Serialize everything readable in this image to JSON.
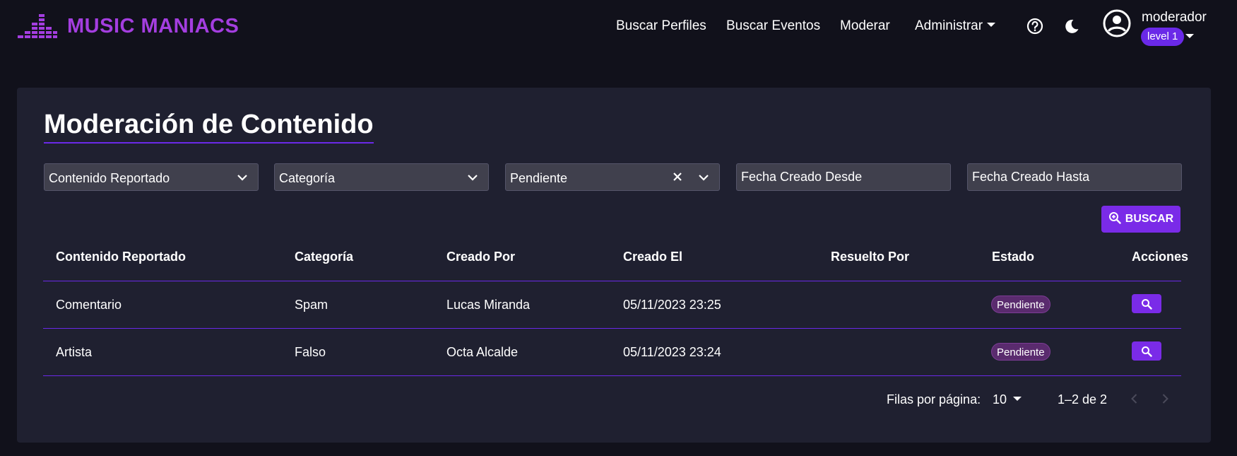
{
  "app": {
    "brand_name": "MUSIC MANIACS",
    "brand_icon": "equalizer-bars-icon",
    "accent_color": "#a43ee0",
    "primary_color": "#7a2be8"
  },
  "nav": {
    "items": [
      {
        "label": "Buscar Perfiles"
      },
      {
        "label": "Buscar Eventos"
      },
      {
        "label": "Moderar"
      },
      {
        "label": "Administrar"
      }
    ],
    "help_icon": "help-circle-icon",
    "theme_icon": "moon-icon"
  },
  "user": {
    "name": "moderador",
    "level": "level 1",
    "avatar_icon": "account-circle-icon"
  },
  "page": {
    "title": "Moderación de Contenido"
  },
  "filters": {
    "content_type": {
      "value": "Contenido Reportado"
    },
    "category": {
      "value": "Categoría"
    },
    "status": {
      "value": "Pendiente"
    },
    "date_from": {
      "placeholder": "Fecha Creado Desde"
    },
    "date_to": {
      "placeholder": "Fecha Creado Hasta"
    },
    "search_label": "BUSCAR"
  },
  "table": {
    "headers": {
      "content": "Contenido Reportado",
      "category": "Categoría",
      "created_by": "Creado Por",
      "created_at": "Creado El",
      "resolved_by": "Resuelto Por",
      "status": "Estado",
      "actions": "Acciones"
    },
    "rows": [
      {
        "content": "Comentario",
        "category": "Spam",
        "created_by": "Lucas Miranda",
        "created_at": "05/11/2023 23:25",
        "resolved_by": "",
        "status": "Pendiente"
      },
      {
        "content": "Artista",
        "category": "Falso",
        "created_by": "Octa Alcalde",
        "created_at": "05/11/2023 23:24",
        "resolved_by": "",
        "status": "Pendiente"
      }
    ]
  },
  "pagination": {
    "rows_per_page_label": "Filas por página:",
    "rows_per_page": "10",
    "range": "1–2 de 2"
  }
}
